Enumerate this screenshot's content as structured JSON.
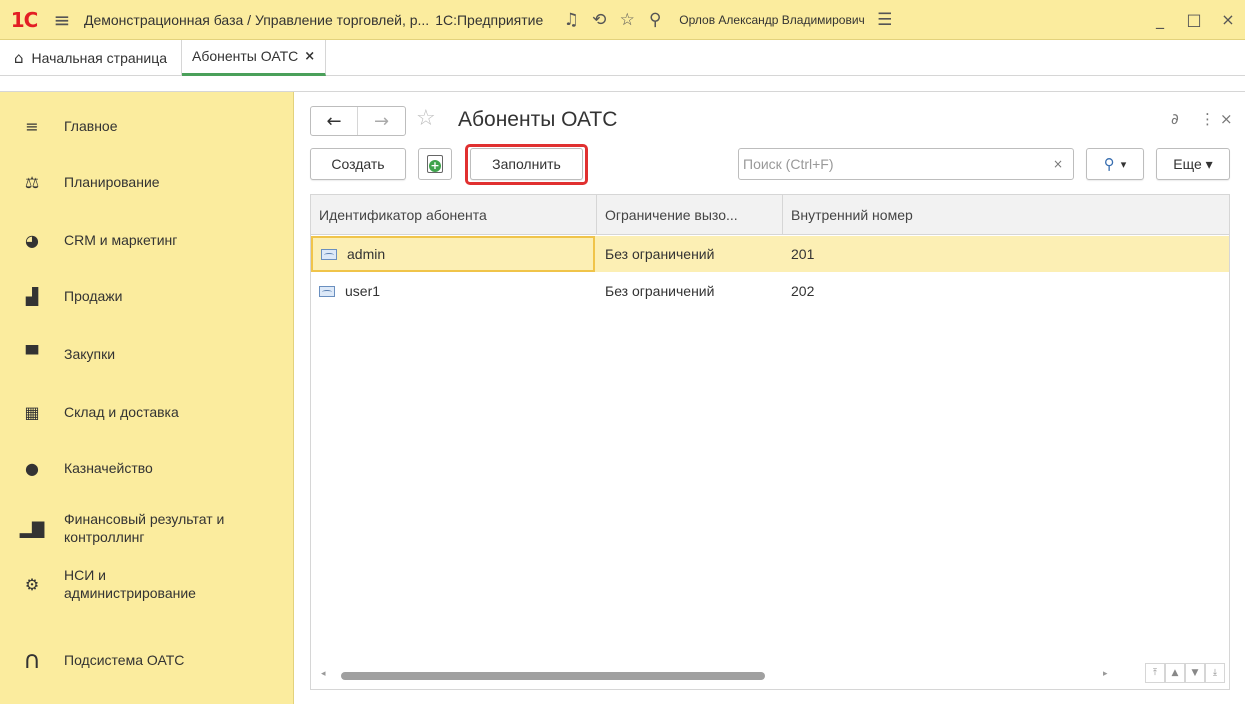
{
  "titlebar": {
    "logo": "1С",
    "title": "Демонстрационная база / Управление торговлей, р...",
    "platform": "1С:Предприятие",
    "user": "Орлов Александр Владимирович",
    "icons": [
      "bell-icon",
      "history-icon",
      "star-icon",
      "search-icon",
      "settings-icon"
    ]
  },
  "tabs": {
    "home_label": "Начальная страница",
    "active_label": "Абоненты ОАТС",
    "close_glyph": "×"
  },
  "sidebar": {
    "items": [
      {
        "label": "Главное",
        "icon": "menu-icon"
      },
      {
        "label": "Планирование",
        "icon": "planning-icon"
      },
      {
        "label": "CRM и маркетинг",
        "icon": "pie-chart-icon"
      },
      {
        "label": "Продажи",
        "icon": "bag-icon"
      },
      {
        "label": "Закупки",
        "icon": "cart-icon"
      },
      {
        "label": "Склад и доставка",
        "icon": "warehouse-icon"
      },
      {
        "label": "Казначейство",
        "icon": "ruble-coin-icon"
      },
      {
        "label": "Финансовый результат и контроллинг",
        "icon": "bar-chart-icon"
      },
      {
        "label": "НСИ и администрирование",
        "icon": "gear-icon"
      },
      {
        "label": "Подсистема ОАТС",
        "icon": "headset-icon"
      }
    ]
  },
  "form": {
    "title": "Абоненты ОАТС",
    "create_label": "Создать",
    "fill_label": "Заполнить",
    "more_label": "Еще ▾",
    "search_placeholder": "Поиск (Ctrl+F)",
    "search_dropdown": "▾"
  },
  "table": {
    "columns": [
      "Идентификатор абонента",
      "Ограничение вызо...",
      "Внутренний номер"
    ],
    "rows": [
      {
        "id": "admin",
        "restriction": "Без ограничений",
        "number": "201",
        "selected": true
      },
      {
        "id": "user1",
        "restriction": "Без ограничений",
        "number": "202",
        "selected": false
      }
    ]
  },
  "colors": {
    "sidebar_bg": "#fbec9e",
    "selection_bg": "#fcefb4",
    "highlight_border": "#e03030",
    "active_tab_underline": "#4aa05a"
  }
}
